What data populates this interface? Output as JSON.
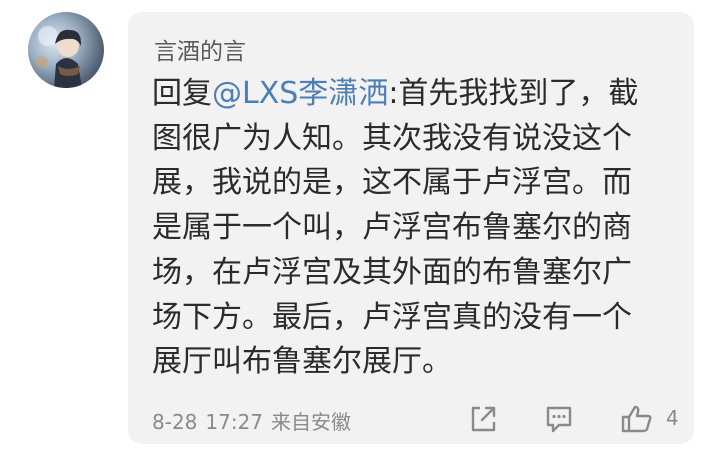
{
  "comment": {
    "username": "言酒的言",
    "reply_prefix": "回复",
    "mention": "@LXS李潇洒",
    "body_lines": [
      ":首先我找到了，截",
      "图很广为人知。其次我没有说没这个",
      "展，我说的是，这不属于卢浮宫。而",
      "是属于一个叫，卢浮宫布鲁塞尔的商",
      "场，在卢浮宫及其外面的布鲁塞尔广",
      "场下方。最后，卢浮宫真的没有一个",
      "展厅叫布鲁塞尔展厅。"
    ],
    "date": "8-28",
    "time": "17:27",
    "source": "来自安徽",
    "like_count": "4"
  },
  "icons": {
    "share": "share-icon",
    "comment": "comment-icon",
    "like": "thumbs-up-icon"
  },
  "colors": {
    "card_background": "#f2f2f2",
    "mention": "#4c7fb6",
    "meta_text": "#8a8a8a"
  }
}
